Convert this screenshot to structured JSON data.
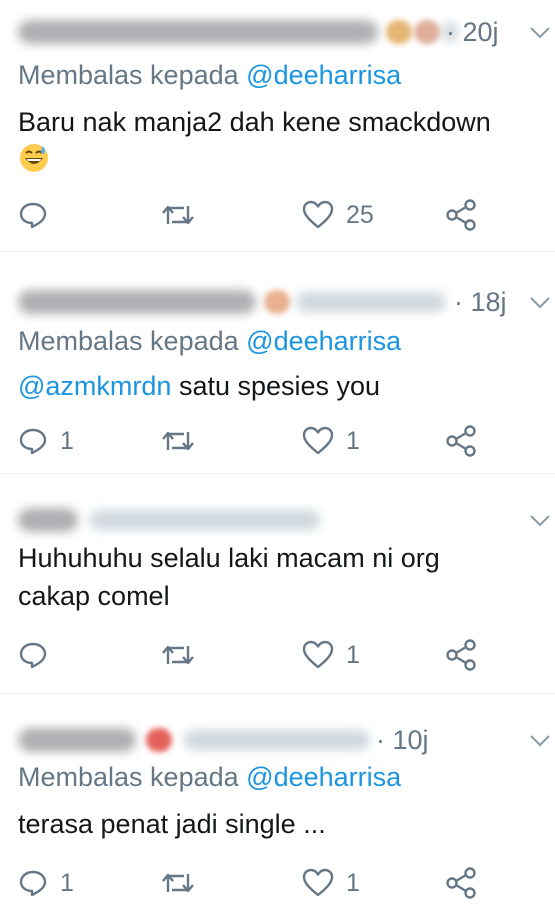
{
  "tweets": [
    {
      "time": "· 20j",
      "reply_prefix": "Membalas kepada",
      "reply_handle": "@deeharrisa",
      "text_line1": "Baru nak manja2 dah kene smackdown",
      "emoji": "grinning-sweat-emoji",
      "replies": "",
      "retweets": "",
      "likes": "25"
    },
    {
      "time": "· 18j",
      "reply_prefix": "Membalas kepada",
      "reply_handle": "@deeharrisa",
      "mention": "@azmkmrdn",
      "text_line1": " satu spesies you",
      "replies": "1",
      "retweets": "",
      "likes": "1"
    },
    {
      "time": "",
      "text_line1": "Huhuhuhu selalu laki macam ni org",
      "text_line2": "cakap comel",
      "replies": "",
      "retweets": "",
      "likes": "1"
    },
    {
      "time": "· 10j",
      "reply_prefix": "Membalas kepada",
      "reply_handle": "@deeharrisa",
      "text_line1": "terasa penat jadi single ...",
      "replies": "1",
      "retweets": "",
      "likes": "1"
    }
  ],
  "colors": {
    "secondary_text": "#657786",
    "link": "#1b95e0",
    "divider": "#e6ecf0",
    "primary_text": "#14171a"
  },
  "icons": [
    "reply-icon",
    "retweet-icon",
    "like-icon",
    "share-icon",
    "chevron-down-icon"
  ]
}
